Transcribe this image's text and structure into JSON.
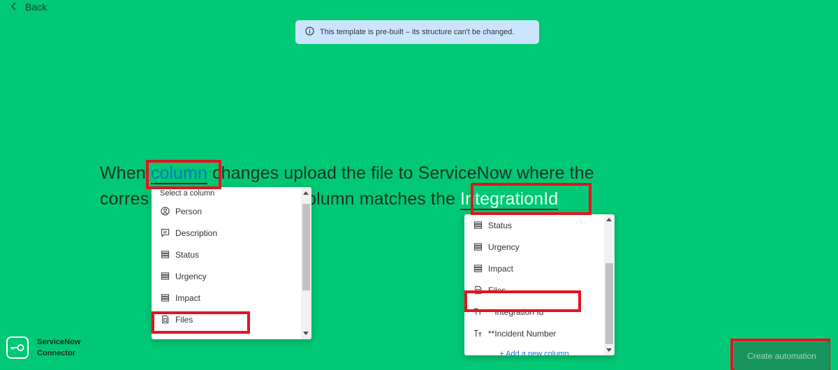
{
  "nav": {
    "back_label": "Back"
  },
  "banner": {
    "text": "This template is pre-built – its structure can't be changed."
  },
  "sentence": {
    "part1": "When ",
    "placeholder1": "column",
    "part2": " changes upload the file to ServiceNow where the",
    "part3": "corres",
    "part4": "olumn matches the ",
    "placeholder2": "IntegrationId"
  },
  "column_dropdown": {
    "header": "Select a column",
    "items": [
      {
        "label": "Person",
        "icon": "person-icon"
      },
      {
        "label": "Description",
        "icon": "description-icon"
      },
      {
        "label": "Status",
        "icon": "status-icon"
      },
      {
        "label": "Urgency",
        "icon": "status-icon"
      },
      {
        "label": "Impact",
        "icon": "status-icon"
      },
      {
        "label": "Files",
        "icon": "file-icon"
      }
    ]
  },
  "field_dropdown": {
    "items": [
      {
        "label": "Status",
        "icon": "status-icon"
      },
      {
        "label": "Urgency",
        "icon": "status-icon"
      },
      {
        "label": "Impact",
        "icon": "status-icon"
      },
      {
        "label": "Files",
        "icon": "file-icon"
      },
      {
        "label": "**Integration Id",
        "icon": "text-icon"
      },
      {
        "label": "**Incident Number",
        "icon": "text-icon"
      }
    ],
    "add_label": "+ Add a new column"
  },
  "brand": {
    "line1": "ServiceNow",
    "line2": "Connector"
  },
  "actions": {
    "create_label": "Create automation"
  },
  "colors": {
    "background": "#00c875",
    "highlight_box": "#e3141f",
    "link": "#0b76c9"
  }
}
